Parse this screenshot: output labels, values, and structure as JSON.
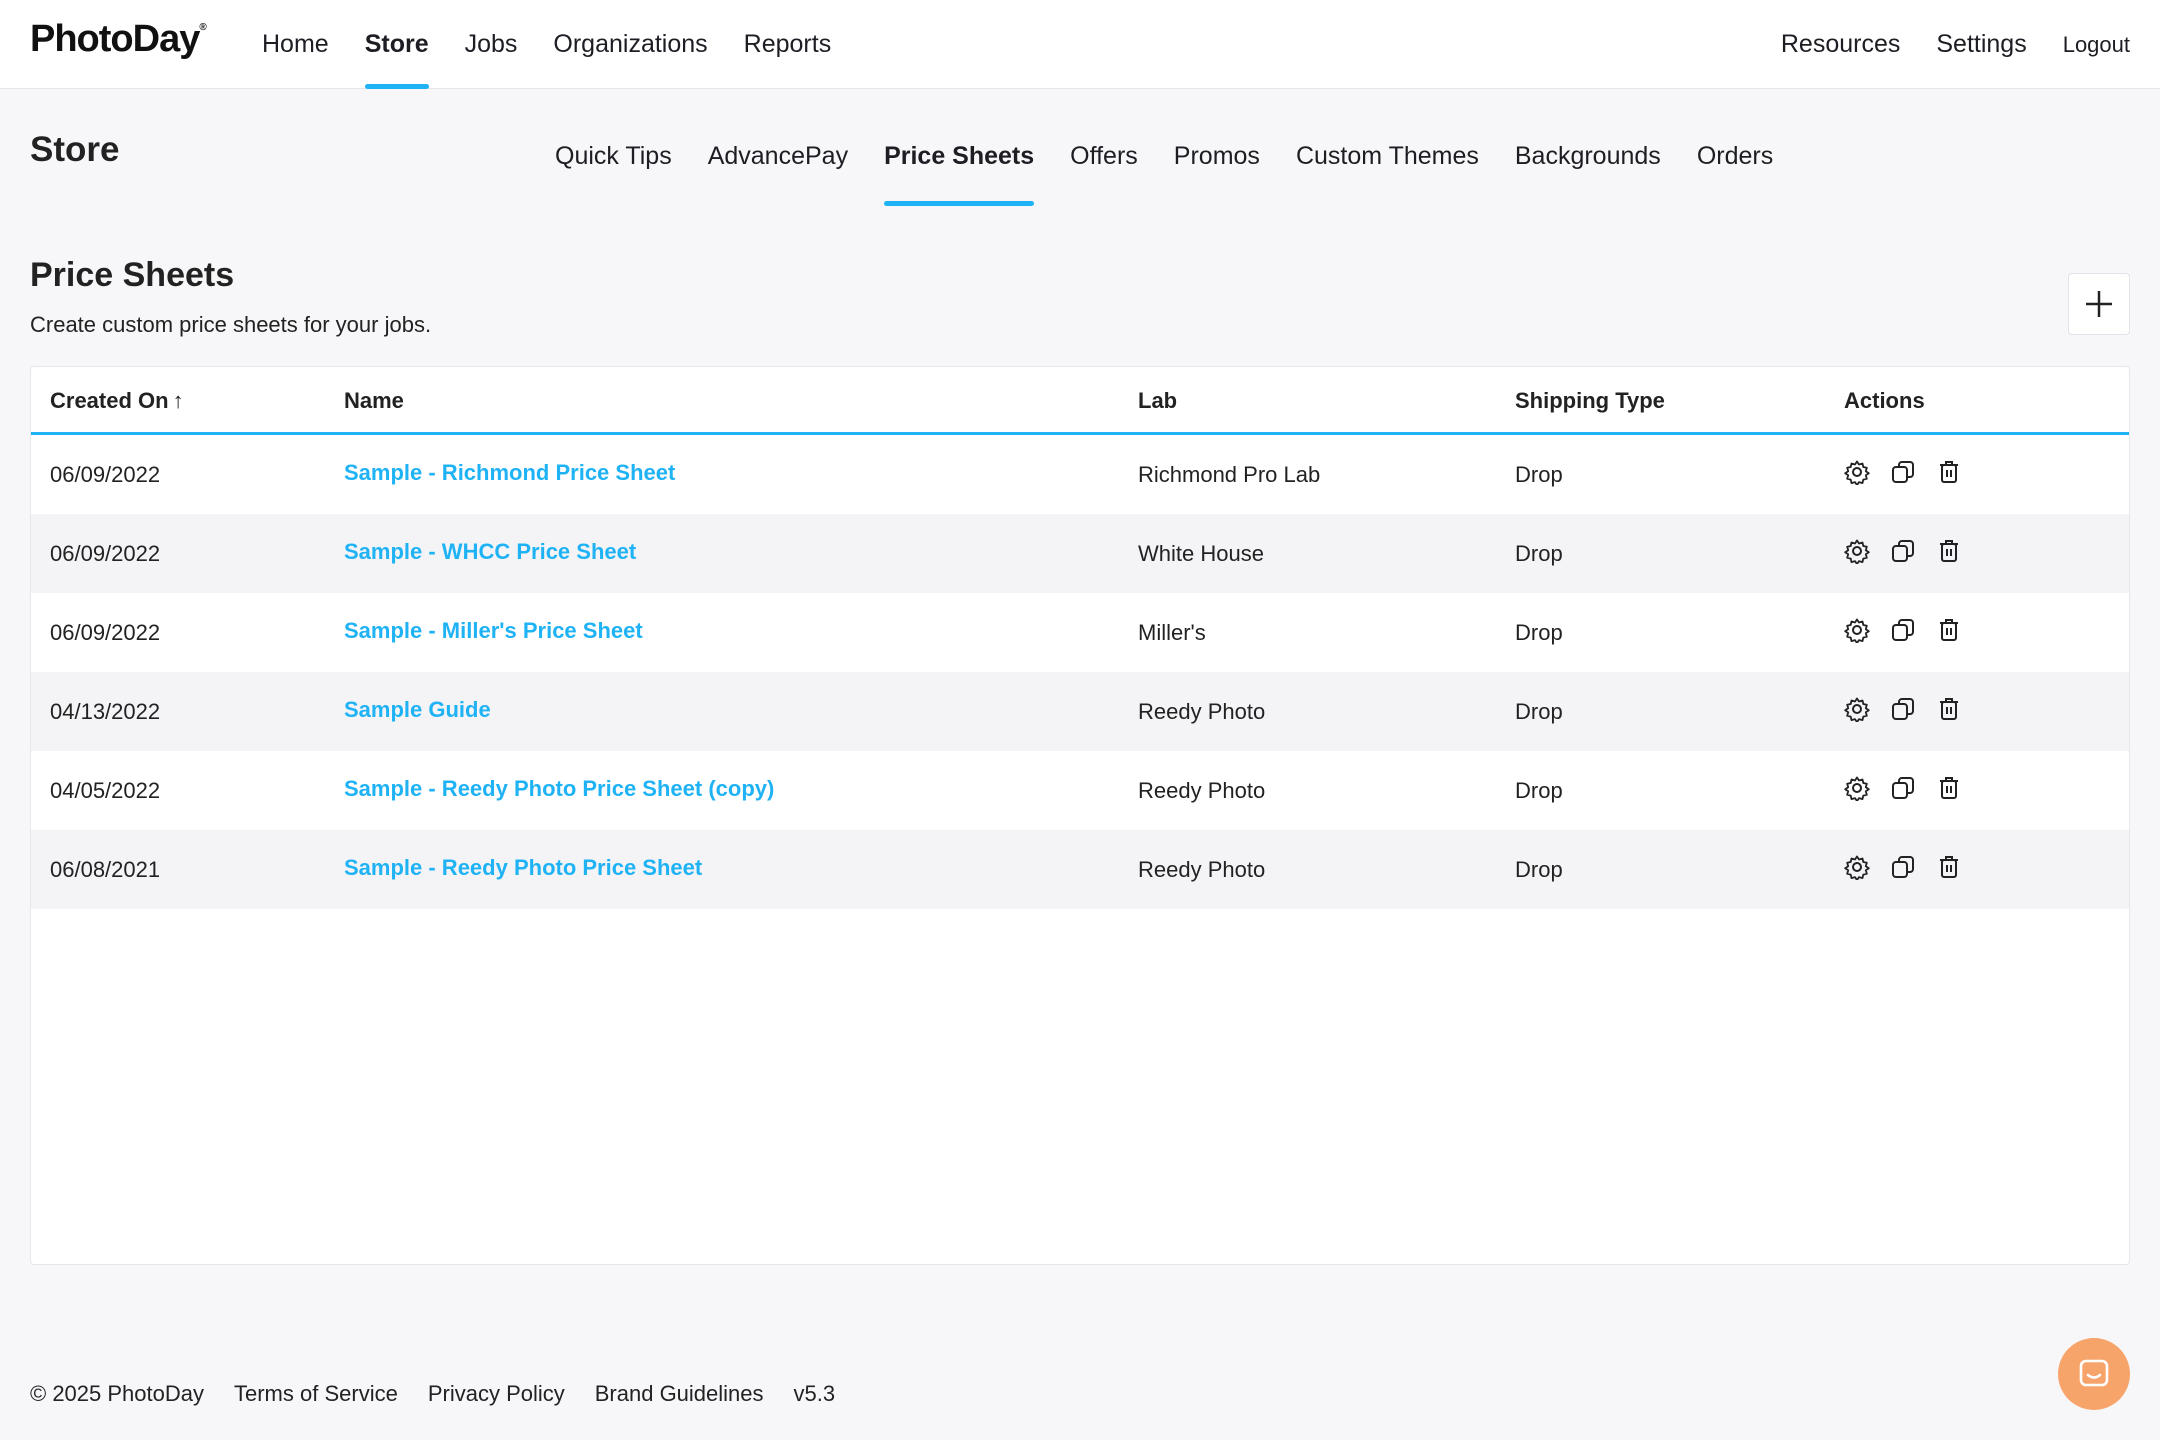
{
  "brand": {
    "name": "PhotoDay",
    "mark": "®",
    "accent_color": "#1fb3f5",
    "link_color": "#1fb3f5"
  },
  "main_nav": [
    {
      "label": "Home",
      "active": false
    },
    {
      "label": "Store",
      "active": true
    },
    {
      "label": "Jobs",
      "active": false
    },
    {
      "label": "Organizations",
      "active": false
    },
    {
      "label": "Reports",
      "active": false
    }
  ],
  "right_nav": {
    "resources": "Resources",
    "settings": "Settings",
    "logout": "Logout"
  },
  "store": {
    "title": "Store",
    "tabs": [
      {
        "label": "Quick Tips",
        "active": false
      },
      {
        "label": "AdvancePay",
        "active": false
      },
      {
        "label": "Price Sheets",
        "active": true
      },
      {
        "label": "Offers",
        "active": false
      },
      {
        "label": "Promos",
        "active": false
      },
      {
        "label": "Custom Themes",
        "active": false
      },
      {
        "label": "Backgrounds",
        "active": false
      },
      {
        "label": "Orders",
        "active": false
      }
    ]
  },
  "section": {
    "title": "Price Sheets",
    "description": "Create custom price sheets for your jobs.",
    "add_icon": "plus-icon"
  },
  "table": {
    "columns": {
      "created_on": "Created On",
      "sort_indicator": "↑",
      "name": "Name",
      "lab": "Lab",
      "shipping_type": "Shipping Type",
      "actions": "Actions"
    },
    "rows": [
      {
        "created_on": "06/09/2022",
        "name": "Sample - Richmond Price Sheet",
        "lab": "Richmond Pro Lab",
        "shipping_type": "Drop"
      },
      {
        "created_on": "06/09/2022",
        "name": "Sample - WHCC Price Sheet",
        "lab": "White House",
        "shipping_type": "Drop"
      },
      {
        "created_on": "06/09/2022",
        "name": "Sample - Miller's Price Sheet",
        "lab": "Miller's",
        "shipping_type": "Drop"
      },
      {
        "created_on": "04/13/2022",
        "name": "Sample Guide",
        "lab": "Reedy Photo",
        "shipping_type": "Drop"
      },
      {
        "created_on": "04/05/2022",
        "name": "Sample - Reedy Photo Price Sheet (copy)",
        "lab": "Reedy Photo",
        "shipping_type": "Drop"
      },
      {
        "created_on": "06/08/2021",
        "name": "Sample - Reedy Photo Price Sheet",
        "lab": "Reedy Photo",
        "shipping_type": "Drop"
      }
    ],
    "action_icons": [
      "gear-icon",
      "copy-icon",
      "trash-icon"
    ]
  },
  "footer": {
    "copyright": "© 2025 PhotoDay",
    "links": [
      "Terms of Service",
      "Privacy Policy",
      "Brand Guidelines"
    ],
    "version": "v5.3"
  },
  "chat": {
    "icon": "chat-icon",
    "color": "#f7a46b"
  }
}
